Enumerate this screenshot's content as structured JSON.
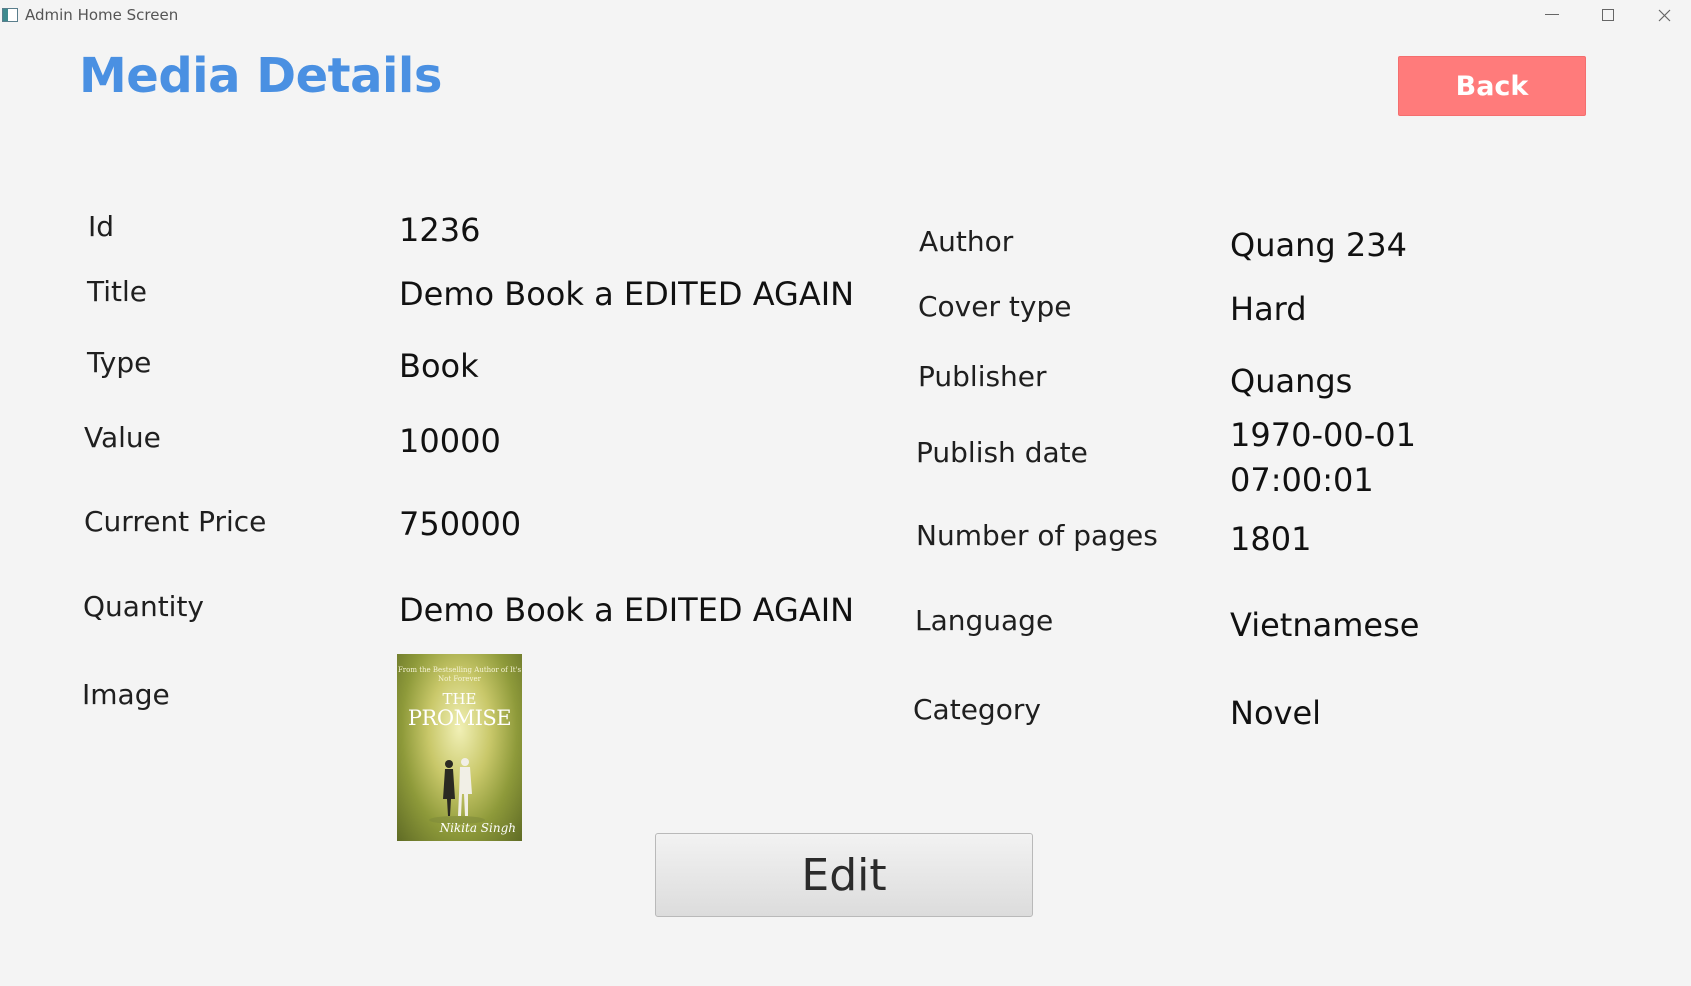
{
  "window": {
    "title": "Admin Home Screen",
    "minimize_icon": "minimize-icon",
    "maximize_icon": "maximize-icon",
    "close_icon": "close-icon"
  },
  "header": {
    "title": "Media Details",
    "back_label": "Back"
  },
  "colors": {
    "title": "#4a90e2",
    "back_button": "#ff7b7b",
    "background": "#f4f4f4"
  },
  "left_fields": [
    {
      "label": "Id",
      "value": "1236"
    },
    {
      "label": "Title",
      "value": "Demo Book a EDITED AGAIN"
    },
    {
      "label": "Type",
      "value": "Book"
    },
    {
      "label": "Value",
      "value": "10000"
    },
    {
      "label": "Current Price",
      "value": "750000"
    },
    {
      "label": "Quantity",
      "value": "Demo Book a EDITED AGAIN"
    },
    {
      "label": "Image",
      "value": ""
    }
  ],
  "right_fields": [
    {
      "label": "Author",
      "value": "Quang 234"
    },
    {
      "label": "Cover type",
      "value": "Hard"
    },
    {
      "label": "Publisher",
      "value": "Quangs"
    },
    {
      "label": "Publish date",
      "value": "1970-00-01 07:00:01"
    },
    {
      "label": "Number of pages",
      "value": "1801"
    },
    {
      "label": "Language",
      "value": "Vietnamese"
    },
    {
      "label": "Category",
      "value": "Novel"
    }
  ],
  "cover": {
    "tagline": "From the Bestselling Author of It's Not Forever",
    "the": "THE",
    "title": "PROMISE",
    "author": "Nikita Singh"
  },
  "actions": {
    "edit_label": "Edit"
  }
}
